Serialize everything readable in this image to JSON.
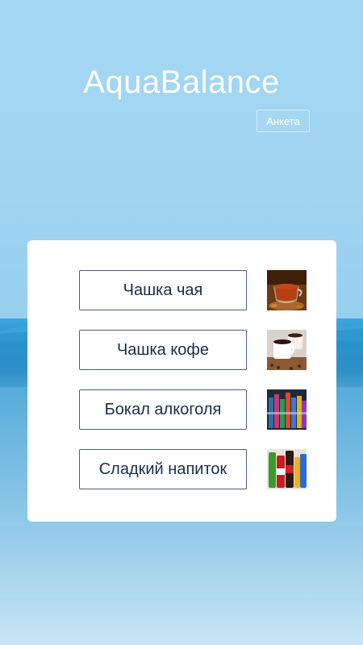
{
  "app": {
    "title": "AquaBalance",
    "survey_label": "Анкета"
  },
  "drinks": [
    {
      "label": "Чашка чая",
      "icon": "tea-cup-photo"
    },
    {
      "label": "Чашка кофе",
      "icon": "coffee-cups-photo"
    },
    {
      "label": "Бокал алкоголя",
      "icon": "alcohol-bottles-photo"
    },
    {
      "label": "Сладкий напиток",
      "icon": "soda-bottles-photo"
    }
  ],
  "colors": {
    "sky": "#a4d7f3",
    "sea": "#2d8fc6",
    "button_border": "#4a5d80",
    "button_text": "#1b2a4a"
  }
}
